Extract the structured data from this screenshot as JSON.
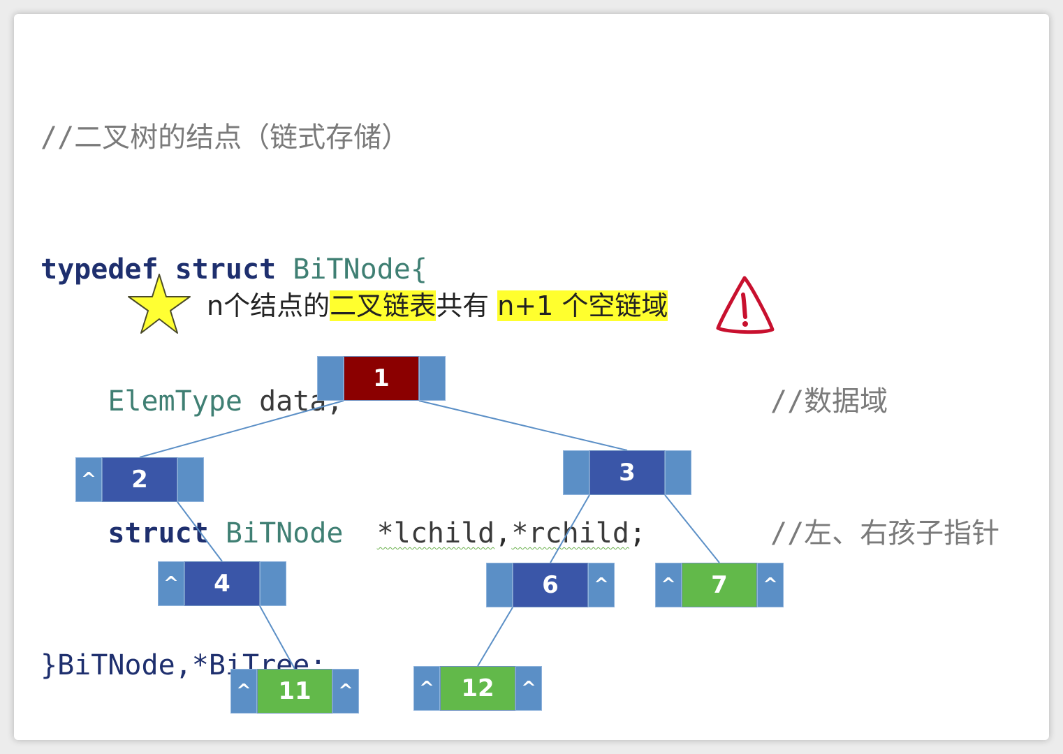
{
  "code": {
    "comment_title": "//二叉树的结点（链式存储）",
    "kw_typedef": "typedef",
    "kw_struct": "struct",
    "struct_name": "BiTNode{",
    "elem_type": "ElemType",
    "data_field": "data;",
    "comment_data": "//数据域",
    "kw_struct2": "struct",
    "struct_name2": "BiTNode",
    "lchild": "*lchild",
    "comma": ",",
    "rchild": "*rchild",
    "semicolon": ";",
    "comment_ptr": "//左、右孩子指针",
    "closing": "}BiTNode,*BiTree;"
  },
  "note": {
    "part1": "n个结点的",
    "part2": "二叉链表",
    "part3": "共有",
    "part4": "n+1 个空链域"
  },
  "colors": {
    "pointer_field": "#5b8fc6",
    "internal_node": "#3a56a8",
    "root_node": "#8b0000",
    "leaf_node": "#62b94a",
    "highlight": "#ffff2e",
    "edge": "#5b8fc6"
  },
  "icons": [
    "star-icon",
    "warning-icon"
  ],
  "tree": {
    "null_marker": "^",
    "nodes": [
      {
        "id": "n1",
        "value": "1",
        "left": "",
        "right": "",
        "kind": "root"
      },
      {
        "id": "n2",
        "value": "2",
        "left": "^",
        "right": "",
        "kind": "internal"
      },
      {
        "id": "n3",
        "value": "3",
        "left": "",
        "right": "",
        "kind": "internal"
      },
      {
        "id": "n4",
        "value": "4",
        "left": "^",
        "right": "",
        "kind": "internal"
      },
      {
        "id": "n6",
        "value": "6",
        "left": "",
        "right": "^",
        "kind": "internal"
      },
      {
        "id": "n7",
        "value": "7",
        "left": "^",
        "right": "^",
        "kind": "leaf"
      },
      {
        "id": "n11",
        "value": "11",
        "left": "^",
        "right": "^",
        "kind": "leaf"
      },
      {
        "id": "n12",
        "value": "12",
        "left": "^",
        "right": "^",
        "kind": "leaf"
      }
    ],
    "edges": [
      [
        "n1",
        "n2"
      ],
      [
        "n1",
        "n3"
      ],
      [
        "n2",
        "n4"
      ],
      [
        "n4",
        "n11"
      ],
      [
        "n3",
        "n6"
      ],
      [
        "n3",
        "n7"
      ],
      [
        "n6",
        "n12"
      ]
    ]
  }
}
